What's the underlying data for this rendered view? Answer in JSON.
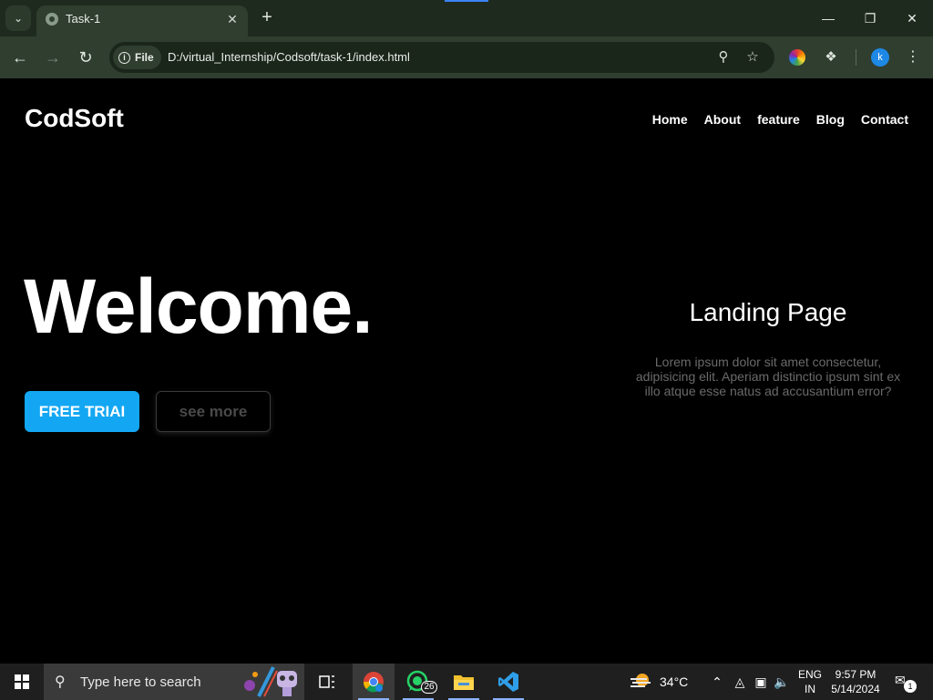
{
  "browser": {
    "tab_title": "Task-1",
    "site_chip": "File",
    "url": "D:/virtual_Internship/Codsoft/task-1/index.html",
    "profile_initial": "k"
  },
  "page": {
    "logo": "CodSoft",
    "nav": [
      "Home",
      "About",
      "feature",
      "Blog",
      "Contact"
    ],
    "hero_title": "Welcome.",
    "primary_button": "FREE TRIAI",
    "secondary_button": "see more",
    "side_title": "Landing Page",
    "side_text": "Lorem ipsum dolor sit amet consectetur, adipisicing elit. Aperiam distinctio ipsum sint ex illo atque esse natus ad accusantium error?"
  },
  "taskbar": {
    "search_placeholder": "Type here to search",
    "whatsapp_badge": "26",
    "temperature": "34°C",
    "lang_line1": "ENG",
    "lang_line2": "IN",
    "time": "9:57 PM",
    "date": "5/14/2024",
    "notification_count": "1"
  },
  "colors": {
    "primary_button": "#13a7f3",
    "page_background": "#000000",
    "browser_frame": "#2f3e2f"
  }
}
